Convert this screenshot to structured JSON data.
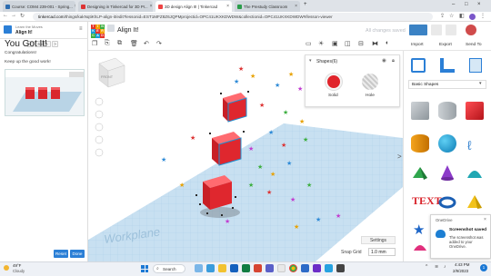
{
  "browser": {
    "tabs": [
      {
        "label": "Course: COM4 239-001 - Spring..."
      },
      {
        "label": "Designing in Tinkercad for 3D Pr..."
      },
      {
        "label": "3D design Align It! | Tinkercad"
      },
      {
        "label": "The Prestudy Classroom"
      }
    ],
    "url_host": "tinkercad.com",
    "url_path": "/things/kakNqtiKhLP-align-it/edit?lessonid=EST1MFZ8Z6JQPMprojectid=OPC41UKXKDWDW&collectionid=OPC41UKXKDWDW#/lesson-viewer",
    "new_tab": "+"
  },
  "lesson": {
    "header_small": "Learn the Moves",
    "header_title": "Align It!",
    "pager_prev": "<",
    "pager_label": "6 of 6",
    "pager_next": ">",
    "title": "You Got It!",
    "congrats": "Congratulations!",
    "keep_up": "Keep up the good work!",
    "reset_button": "Reset",
    "done_button": "Done"
  },
  "header": {
    "logo_letters": [
      "T",
      "I",
      "N",
      "K",
      "E",
      "R",
      "C",
      "A",
      "D"
    ],
    "design_name": "Align It!",
    "all_saved": "All changes saved",
    "import_label": "Import",
    "export_label": "Export",
    "send_label": "Send To"
  },
  "viewport": {
    "home_cube_label": "FRONT",
    "workplane_label": "Workplane",
    "settings_label": "Settings",
    "snap_grid_label": "Snap Grid",
    "snap_grid_value": "1.0 mm"
  },
  "shapes_panel": {
    "title": "Shapes(6)",
    "solid_label": "Solid",
    "hole_label": "Hole"
  },
  "library": {
    "category": "Basic Shapes",
    "collapse_glyph": ">"
  },
  "taskbar": {
    "weather_temp": "49°F",
    "weather_desc": "Cloudy",
    "search_label": "Search",
    "time": "4:43 PM",
    "date": "2/9/2023"
  },
  "notification": {
    "app": "OneDrive",
    "title": "Screenshot saved",
    "body": "The screenshot was added to your OneDrive."
  }
}
